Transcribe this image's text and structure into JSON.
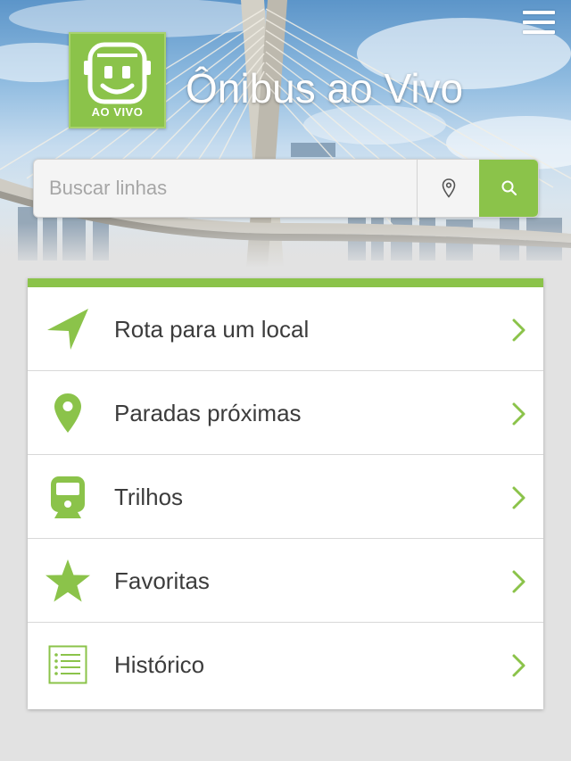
{
  "app": {
    "title": "Ônibus ao Vivo",
    "logo_text": "AO VIVO",
    "accent_color": "#8bc34a"
  },
  "header": {
    "menu_icon": "hamburger-menu-icon"
  },
  "search": {
    "placeholder": "Buscar linhas",
    "value": "",
    "location_icon": "map-pin-outline-icon",
    "search_icon": "magnifier-icon"
  },
  "menu": {
    "items": [
      {
        "label": "Rota para um local",
        "icon": "navigation-arrow-icon"
      },
      {
        "label": "Paradas próximas",
        "icon": "map-pin-icon"
      },
      {
        "label": "Trilhos",
        "icon": "train-icon"
      },
      {
        "label": "Favoritas",
        "icon": "star-icon"
      },
      {
        "label": "Histórico",
        "icon": "list-icon"
      }
    ],
    "chevron_icon": "chevron-right-icon"
  }
}
